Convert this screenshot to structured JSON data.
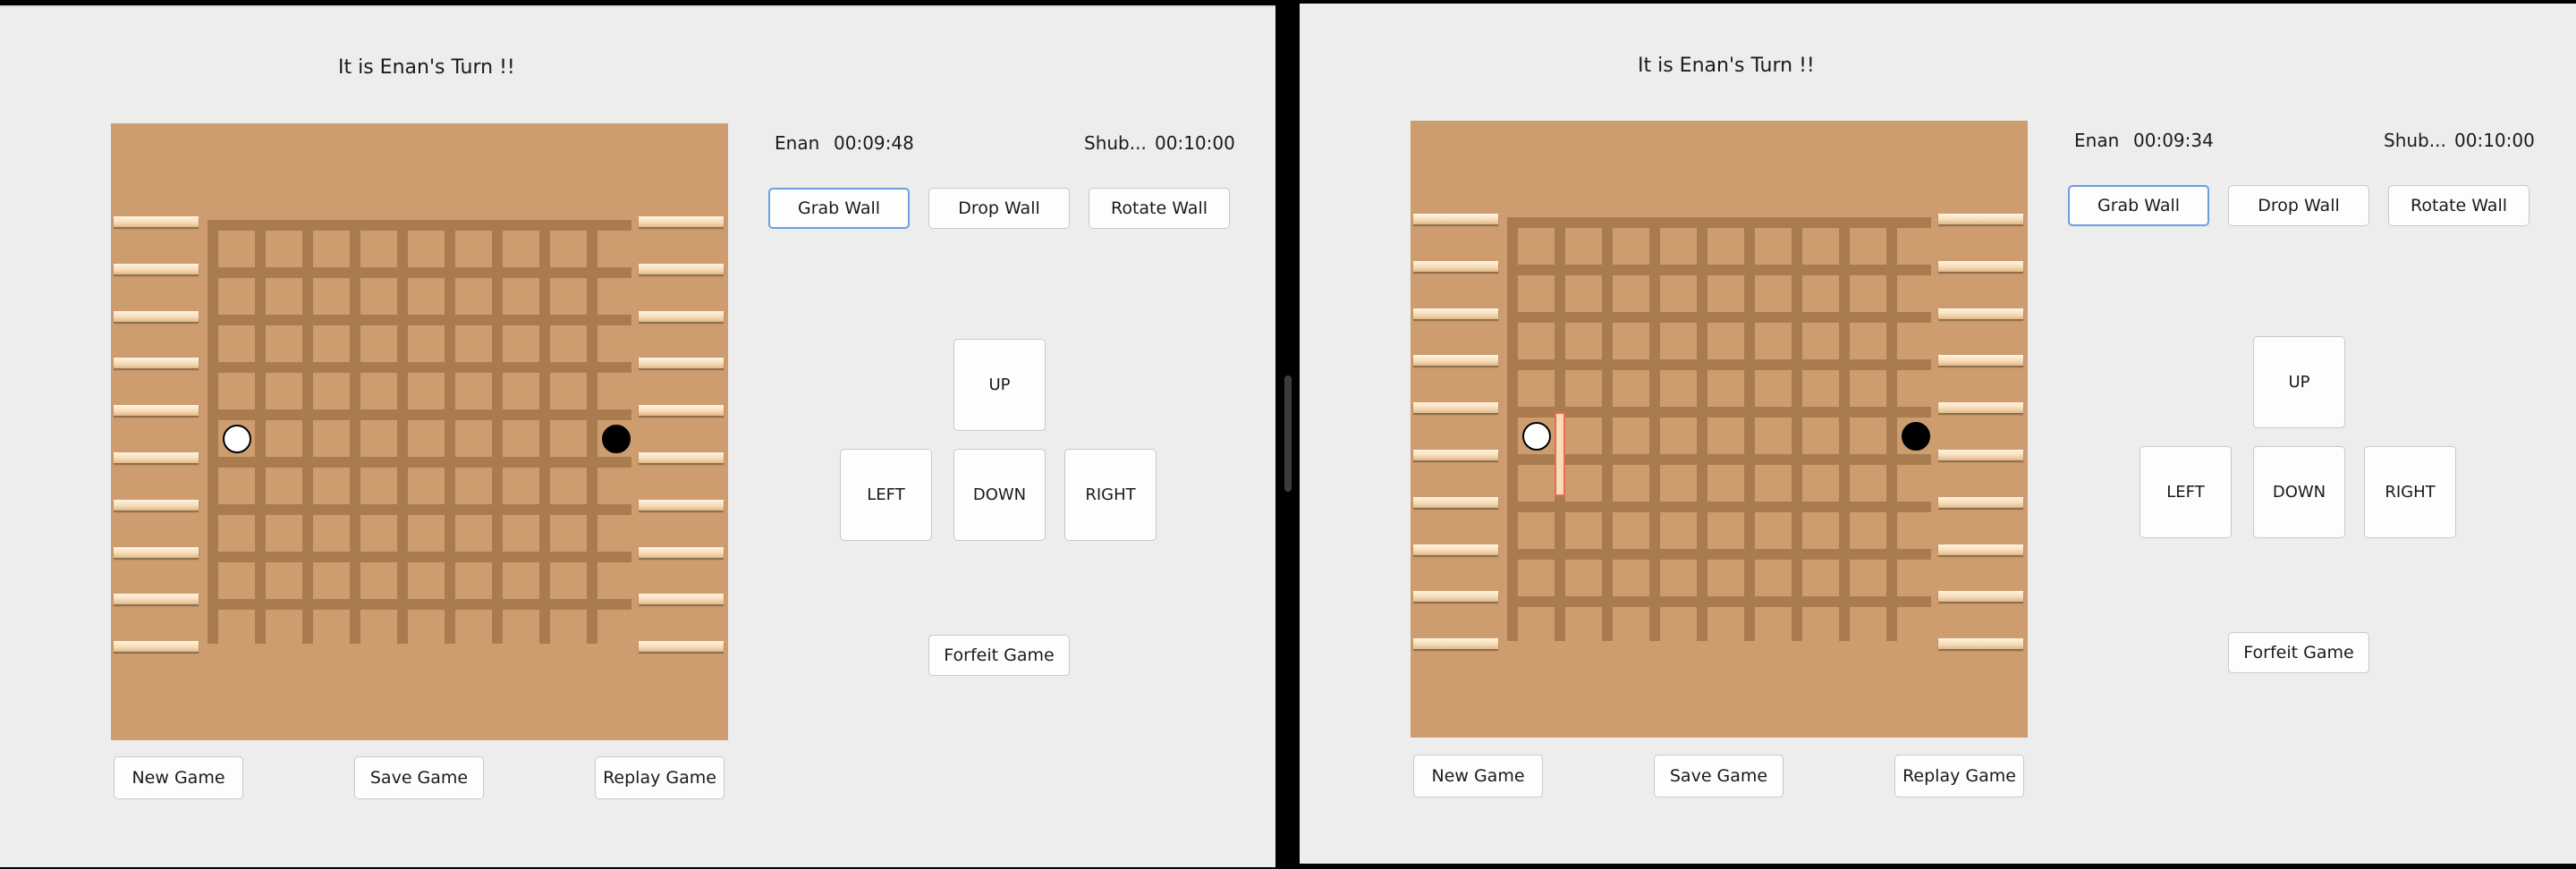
{
  "windows": [
    {
      "turn_text": "It is Enan's Turn !!",
      "player1": {
        "name": "Enan",
        "time": "00:09:48"
      },
      "player2": {
        "name": "Shub...",
        "time": "00:10:00"
      },
      "wall_buttons": {
        "grab": "Grab Wall",
        "drop": "Drop Wall",
        "rotate": "Rotate Wall"
      },
      "move_buttons": {
        "up": "UP",
        "left": "LEFT",
        "down": "DOWN",
        "right": "RIGHT"
      },
      "forfeit": "Forfeit Game",
      "bottom_buttons": {
        "new": "New Game",
        "save": "Save Game",
        "replay": "Replay Game"
      },
      "board": {
        "size": 9,
        "walls_per_player": 10,
        "white_pawn": {
          "row": 5,
          "col": 1
        },
        "black_pawn": {
          "row": 5,
          "col": 9
        },
        "held_wall": null
      }
    },
    {
      "turn_text": "It is Enan's Turn !!",
      "player1": {
        "name": "Enan",
        "time": "00:09:34"
      },
      "player2": {
        "name": "Shub...",
        "time": "00:10:00"
      },
      "wall_buttons": {
        "grab": "Grab Wall",
        "drop": "Drop Wall",
        "rotate": "Rotate Wall"
      },
      "move_buttons": {
        "up": "UP",
        "left": "LEFT",
        "down": "DOWN",
        "right": "RIGHT"
      },
      "forfeit": "Forfeit Game",
      "bottom_buttons": {
        "new": "New Game",
        "save": "Save Game",
        "replay": "Replay Game"
      },
      "board": {
        "size": 9,
        "walls_per_player": 10,
        "white_pawn": {
          "row": 5,
          "col": 1
        },
        "black_pawn": {
          "row": 5,
          "col": 9
        },
        "held_wall": {
          "orientation": "vertical",
          "after_col": 1,
          "row": 5
        }
      }
    }
  ],
  "colors": {
    "board": "#cd9d6f",
    "groove": "#a97c4f",
    "wall": "#f7dcb7",
    "held_wall_outline": "#e86a5a",
    "focus": "#6a9fe0",
    "window_bg": "#ededed"
  }
}
